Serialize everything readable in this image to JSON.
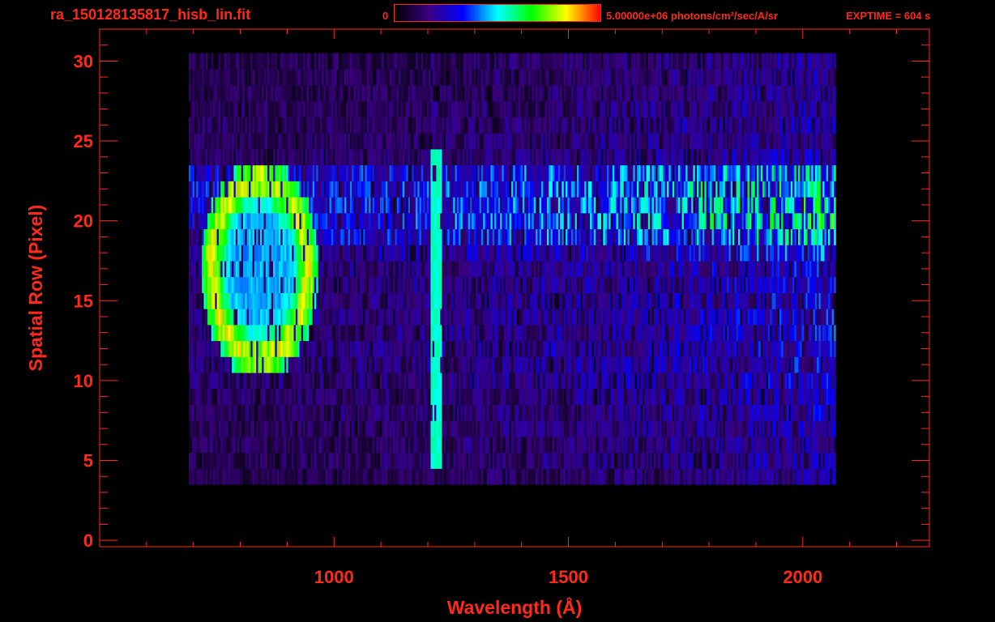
{
  "header": {
    "title": "ra_150128135817_hisb_lin.fit",
    "colorbar_min": "0",
    "colorbar_max_label": "5.00000e+06 photons/cm²/sec/A/sr",
    "exptime": "EXPTIME = 604 s"
  },
  "colors": {
    "axis": "#ff2a1a",
    "colormap": [
      "#000000",
      "#3a0080",
      "#0000ff",
      "#00ffff",
      "#00ff00",
      "#ffff00",
      "#ff0000"
    ]
  },
  "chart_data": {
    "type": "heatmap",
    "title": "ra_150128135817_hisb_lin.fit",
    "xlabel": "Wavelength (Å)",
    "ylabel": "Spatial Row (Pixel)",
    "xlim": [
      500,
      2270
    ],
    "ylim": [
      -0.4,
      32
    ],
    "x_ticks": [
      1000,
      1500,
      2000
    ],
    "y_ticks": [
      0,
      5,
      10,
      15,
      20,
      25,
      30
    ],
    "colorbar": {
      "min": 0,
      "max": 5000000,
      "units": "photons/cm²/sec/A/sr"
    },
    "rows": [
      {
        "row": 4,
        "x_start": 690,
        "x_end": 2070,
        "intensity": 0.18
      },
      {
        "row": 5,
        "x_start": 690,
        "x_end": 2070,
        "intensity": 0.2
      },
      {
        "row": 6,
        "x_start": 690,
        "x_end": 2070,
        "intensity": 0.2
      },
      {
        "row": 7,
        "x_start": 690,
        "x_end": 2070,
        "intensity": 0.2
      },
      {
        "row": 8,
        "x_start": 690,
        "x_end": 2070,
        "intensity": 0.22
      },
      {
        "row": 9,
        "x_start": 690,
        "x_end": 2070,
        "intensity": 0.22
      },
      {
        "row": 10,
        "x_start": 690,
        "x_end": 2070,
        "intensity": 0.24
      },
      {
        "row": 11,
        "x_start": 690,
        "x_end": 2070,
        "intensity": 0.25
      },
      {
        "row": 12,
        "x_start": 690,
        "x_end": 2070,
        "intensity": 0.25
      },
      {
        "row": 13,
        "x_start": 690,
        "x_end": 2070,
        "intensity": 0.25
      },
      {
        "row": 14,
        "x_start": 690,
        "x_end": 2070,
        "intensity": 0.25
      },
      {
        "row": 15,
        "x_start": 690,
        "x_end": 2070,
        "intensity": 0.25
      },
      {
        "row": 16,
        "x_start": 690,
        "x_end": 2070,
        "intensity": 0.25
      },
      {
        "row": 17,
        "x_start": 690,
        "x_end": 2070,
        "intensity": 0.25
      },
      {
        "row": 18,
        "x_start": 690,
        "x_end": 2070,
        "intensity": 0.3
      },
      {
        "row": 19,
        "x_start": 690,
        "x_end": 2070,
        "intensity": 0.42
      },
      {
        "row": 20,
        "x_start": 690,
        "x_end": 2070,
        "intensity": 0.45
      },
      {
        "row": 21,
        "x_start": 690,
        "x_end": 2070,
        "intensity": 0.45
      },
      {
        "row": 22,
        "x_start": 690,
        "x_end": 2070,
        "intensity": 0.45
      },
      {
        "row": 23,
        "x_start": 690,
        "x_end": 2070,
        "intensity": 0.42
      },
      {
        "row": 24,
        "x_start": 690,
        "x_end": 2070,
        "intensity": 0.22
      },
      {
        "row": 25,
        "x_start": 690,
        "x_end": 2070,
        "intensity": 0.2
      },
      {
        "row": 26,
        "x_start": 690,
        "x_end": 2070,
        "intensity": 0.2
      },
      {
        "row": 27,
        "x_start": 690,
        "x_end": 2070,
        "intensity": 0.2
      },
      {
        "row": 28,
        "x_start": 690,
        "x_end": 2070,
        "intensity": 0.18
      },
      {
        "row": 29,
        "x_start": 690,
        "x_end": 2070,
        "intensity": 0.18
      },
      {
        "row": 30,
        "x_start": 690,
        "x_end": 2070,
        "intensity": 0.18
      }
    ],
    "features": [
      {
        "name": "Lyman-alpha line",
        "x_center": 1216,
        "row_min": 5,
        "row_max": 24,
        "intensity": 0.55
      },
      {
        "name": "airglow ring",
        "x_center": 840,
        "row_center": 17,
        "rows_half_extent": 6.5,
        "x_half_extent": 120,
        "intensity": 0.85
      }
    ]
  }
}
